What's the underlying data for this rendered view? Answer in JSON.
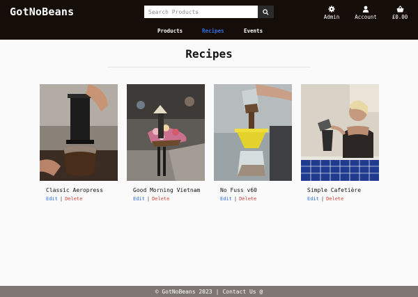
{
  "header": {
    "brand": "GotNoBeans",
    "search": {
      "placeholder": "Search Products"
    },
    "actions": [
      {
        "label": "Admin",
        "icon": "gear-icon"
      },
      {
        "label": "Account",
        "icon": "user-icon"
      },
      {
        "label": "£0.00",
        "icon": "basket-icon"
      }
    ]
  },
  "nav": {
    "items": [
      {
        "label": "Products",
        "active": false
      },
      {
        "label": "Recipes",
        "active": true
      },
      {
        "label": "Events",
        "active": false
      }
    ]
  },
  "main": {
    "title": "Recipes",
    "cards": [
      {
        "name": "Classic Aeropress",
        "edit": "Edit",
        "separator": "|",
        "delete": "Delete"
      },
      {
        "name": "Good Morning Vietnam",
        "edit": "Edit",
        "separator": "|",
        "delete": "Delete"
      },
      {
        "name": "No Fuss v60",
        "edit": "Edit",
        "separator": "|",
        "delete": "Delete"
      },
      {
        "name": "Simple Cafetière",
        "edit": "Edit",
        "separator": "|",
        "delete": "Delete"
      }
    ]
  },
  "footer": {
    "copyright": "© GotNoBeans 2023",
    "separator": "|",
    "contact": "Contact Us @"
  },
  "colors": {
    "header_bg": "#150d08",
    "active_nav": "#2f6fe0",
    "edit_link": "#2f6fe0",
    "delete_link": "#d0453a",
    "footer_bg": "#7e7773"
  }
}
